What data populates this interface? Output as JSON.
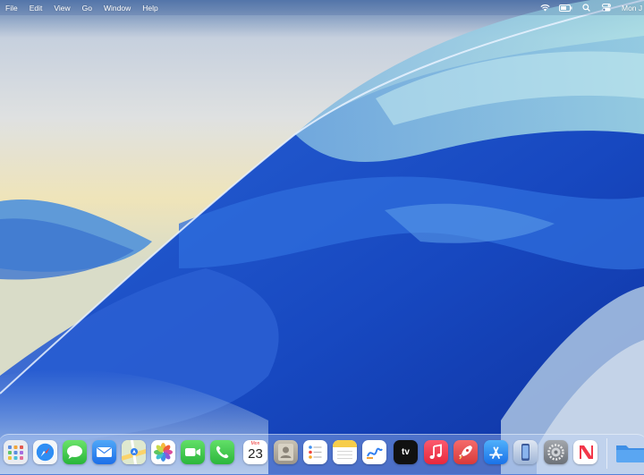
{
  "menubar": {
    "items": [
      "File",
      "Edit",
      "View",
      "Go",
      "Window",
      "Help"
    ],
    "clock_text": "Mon J",
    "status_icons": [
      "wifi-icon",
      "battery-icon",
      "search-icon",
      "control-center-icon"
    ]
  },
  "dock": {
    "apps": [
      {
        "name": "launchpad",
        "icon": "launchpad-icon"
      },
      {
        "name": "safari",
        "icon": "safari-icon"
      },
      {
        "name": "messages",
        "icon": "messages-icon"
      },
      {
        "name": "mail",
        "icon": "mail-icon"
      },
      {
        "name": "maps",
        "icon": "maps-icon"
      },
      {
        "name": "photos",
        "icon": "photos-icon"
      },
      {
        "name": "facetime",
        "icon": "facetime-icon"
      },
      {
        "name": "phone",
        "icon": "phone-icon"
      },
      {
        "name": "calendar",
        "icon": "calendar-icon"
      },
      {
        "name": "contacts",
        "icon": "contacts-icon"
      },
      {
        "name": "reminders",
        "icon": "reminders-icon"
      },
      {
        "name": "notes",
        "icon": "notes-icon"
      },
      {
        "name": "freeform",
        "icon": "freeform-icon"
      },
      {
        "name": "tv",
        "icon": "tv-icon"
      },
      {
        "name": "music",
        "icon": "music-icon"
      },
      {
        "name": "rocket-typist",
        "icon": "rocket-icon"
      },
      {
        "name": "app-store",
        "icon": "app-store-icon"
      },
      {
        "name": "iphone-mirroring",
        "icon": "iphone-mirroring-icon"
      },
      {
        "name": "system-settings",
        "icon": "settings-icon"
      },
      {
        "name": "news",
        "icon": "news-icon"
      },
      {
        "name": "downloads-folder",
        "icon": "folder-icon"
      }
    ],
    "calendar": {
      "month": "Mon",
      "day": "23"
    },
    "tv_label": "tv"
  },
  "colors": {
    "wallpaper_top": "#e3e6ea",
    "wallpaper_sand": "#efe3b6",
    "wallpaper_blue": "#1f55c8",
    "wallpaper_deep": "#0d36a8"
  }
}
